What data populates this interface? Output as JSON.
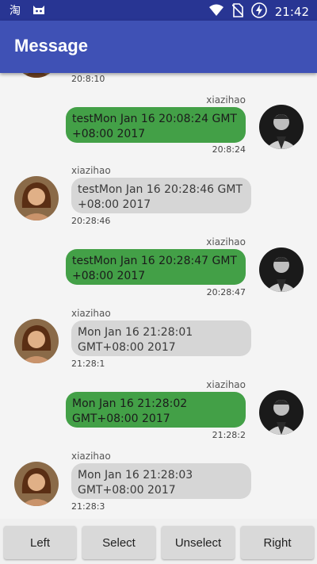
{
  "status_bar": {
    "time": "21:42",
    "icons": [
      "taobao-icon",
      "cat-icon",
      "wifi-icon",
      "no-sim-icon",
      "battery-charging-icon"
    ]
  },
  "app_bar": {
    "title": "Message"
  },
  "messages": [
    {
      "side": "left",
      "name": "",
      "text": "",
      "time": "20:8:10"
    },
    {
      "side": "right",
      "name": "xiazihao",
      "text": "testMon Jan 16 20:08:24 GMT +08:00 2017",
      "time": "20:8:24"
    },
    {
      "side": "left",
      "name": "xiazihao",
      "text": "testMon Jan 16 20:28:46 GMT +08:00 2017",
      "time": "20:28:46"
    },
    {
      "side": "right",
      "name": "xiazihao",
      "text": "testMon Jan 16 20:28:47 GMT +08:00 2017",
      "time": "20:28:47"
    },
    {
      "side": "left",
      "name": "xiazihao",
      "text": "Mon Jan 16 21:28:01 GMT+08:00 2017",
      "time": "21:28:1"
    },
    {
      "side": "right",
      "name": "xiazihao",
      "text": "Mon Jan 16 21:28:02 GMT+08:00 2017",
      "time": "21:28:2"
    },
    {
      "side": "left",
      "name": "xiazihao",
      "text": "Mon Jan 16 21:28:03 GMT+08:00 2017",
      "time": "21:28:3"
    }
  ],
  "buttons": {
    "left": "Left",
    "select": "Select",
    "unselect": "Unselect",
    "right": "Right"
  },
  "colors": {
    "status_bar": "#283593",
    "app_bar": "#3f51b5",
    "sent_bubble": "#43a047",
    "received_bubble": "#d6d6d6"
  }
}
